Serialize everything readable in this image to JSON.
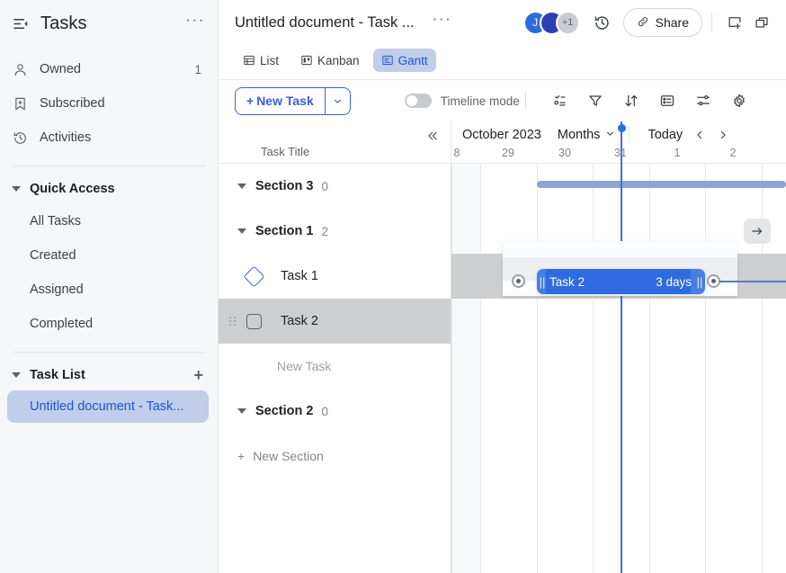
{
  "sidebar": {
    "title": "Tasks",
    "header_icon": "list-collapse-icon",
    "more_label": "···",
    "nav": [
      {
        "label": "Owned",
        "icon": "person-icon",
        "count": "1"
      },
      {
        "label": "Subscribed",
        "icon": "bookmark-star-icon",
        "count": ""
      },
      {
        "label": "Activities",
        "icon": "history-clock-icon",
        "count": ""
      }
    ],
    "quick_access": {
      "label": "Quick Access",
      "items": [
        {
          "label": "All Tasks"
        },
        {
          "label": "Created"
        },
        {
          "label": "Assigned"
        },
        {
          "label": "Completed"
        }
      ]
    },
    "task_list": {
      "label": "Task List",
      "add_label": "+",
      "items": [
        {
          "label": "Untitled document - Task...",
          "active": true
        }
      ]
    }
  },
  "topbar": {
    "doc_title": "Untitled document - Task ...",
    "more_label": "···",
    "avatars": [
      {
        "initial": "J",
        "color": "#2f6be0"
      },
      {
        "initial": "",
        "color": "#2b3fb5"
      },
      {
        "initial": "+1",
        "color": "#c9ccd1"
      }
    ],
    "history_icon": "history-clock-icon",
    "share_label": "Share",
    "share_icon": "link-icon",
    "add_panel_icon": "add-panel-icon",
    "open_window_icon": "open-window-icon"
  },
  "tabs": [
    {
      "label": "List",
      "icon": "list-view-icon",
      "active": false
    },
    {
      "label": "Kanban",
      "icon": "kanban-view-icon",
      "active": false
    },
    {
      "label": "Gantt",
      "icon": "gantt-view-icon",
      "active": true
    }
  ],
  "toolbar": {
    "new_task_label": "New Task",
    "new_task_plus": "+",
    "dropdown_icon": "chevron-down-icon",
    "timeline_mode_label": "Timeline mode",
    "timeline_mode_on": false,
    "icons": [
      {
        "name": "group-by-icon"
      },
      {
        "name": "filter-icon"
      },
      {
        "name": "sort-icon"
      },
      {
        "name": "fields-icon"
      },
      {
        "name": "settings-sliders-icon"
      },
      {
        "name": "gear-icon"
      }
    ]
  },
  "gantt": {
    "collapse_icon": "collapse-left-icon",
    "task_title_header": "Task Title",
    "month_label": "October 2023",
    "scale_label": "Months",
    "scale_caret": "chevron-down-icon",
    "today_label": "Today",
    "prev_icon": "chevron-left-icon",
    "next_icon": "chevron-right-icon",
    "days": [
      "8",
      "29",
      "30",
      "31",
      "1",
      "2"
    ],
    "rows": [
      {
        "type": "section",
        "label": "Section 3",
        "count": "0"
      },
      {
        "type": "section",
        "label": "Section 1",
        "count": "2"
      },
      {
        "type": "task",
        "label": "Task 1",
        "marker": "milestone-diamond-icon",
        "selected": false
      },
      {
        "type": "task",
        "label": "Task 2",
        "marker": "checkbox-icon",
        "selected": true
      },
      {
        "type": "new-task",
        "label": "New Task"
      },
      {
        "type": "section",
        "label": "Section 2",
        "count": "0"
      },
      {
        "type": "new-section",
        "label": "New Section",
        "plus": "+"
      }
    ],
    "bar": {
      "task_label": "Task 2",
      "duration_label": "3 days",
      "grip_left": "||",
      "grip_right": "||"
    },
    "jump_arrow_icon": "arrow-right-icon"
  },
  "colors": {
    "accent": "#2f6be0",
    "accent_soft": "#8ea4d2",
    "active_tab_bg": "#c2cdea",
    "sidebar_bg": "#f6f7f9"
  }
}
